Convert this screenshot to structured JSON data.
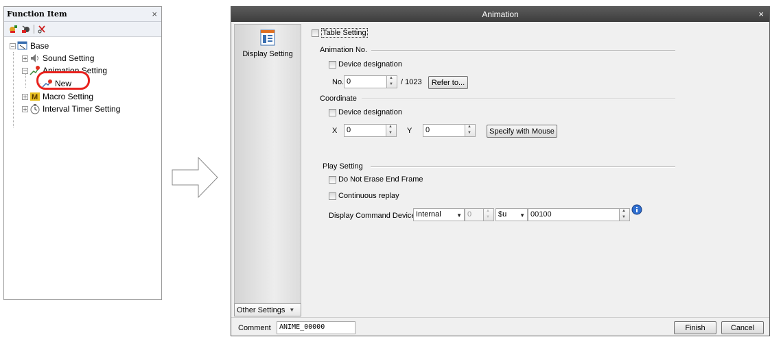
{
  "function_panel": {
    "title": "Function Item",
    "close_glyph": "×",
    "toolbar_icons": [
      "add-item-icon",
      "delete-item-icon",
      "cut-item-icon"
    ],
    "tree": {
      "root": "Base",
      "items": [
        {
          "label": "Sound Setting",
          "icon": "speaker-icon"
        },
        {
          "label": "Animation Setting",
          "icon": "animation-icon"
        },
        {
          "label": "New",
          "icon": "new-animation-icon"
        },
        {
          "label": "Macro Setting",
          "icon": "macro-icon"
        },
        {
          "label": "Interval Timer Setting",
          "icon": "timer-icon"
        }
      ]
    },
    "highlight_color": "#e8211d"
  },
  "dialog": {
    "title": "Animation",
    "close_glyph": "×",
    "sidebar": {
      "display_setting": "Display Setting",
      "other_settings": "Other Settings"
    },
    "table_setting": "Table Setting",
    "animation_no": {
      "section": "Animation No.",
      "device_designation": "Device designation",
      "no_label": "No.",
      "no_value": "0",
      "max": "/ 1023",
      "refer_button": "Refer to..."
    },
    "coordinate": {
      "section": "Coordinate",
      "device_designation": "Device designation",
      "x_label": "X",
      "x_value": "0",
      "y_label": "Y",
      "y_value": "0",
      "mouse_button": "Specify with Mouse"
    },
    "play_setting": {
      "section": "Play Setting",
      "do_not_erase": "Do Not Erase End Frame",
      "continuous_replay": "Continuous replay",
      "display_command_label": "Display Command Device",
      "device_type": "Internal",
      "station_no": "0",
      "device_prefix": "$u",
      "device_address": "00100",
      "info_icon": "info-icon"
    },
    "comment_label": "Comment",
    "comment_value": "ANIME_00000",
    "finish_button": "Finish",
    "cancel_button": "Cancel",
    "titlebar_color": "#4a4a4a"
  }
}
